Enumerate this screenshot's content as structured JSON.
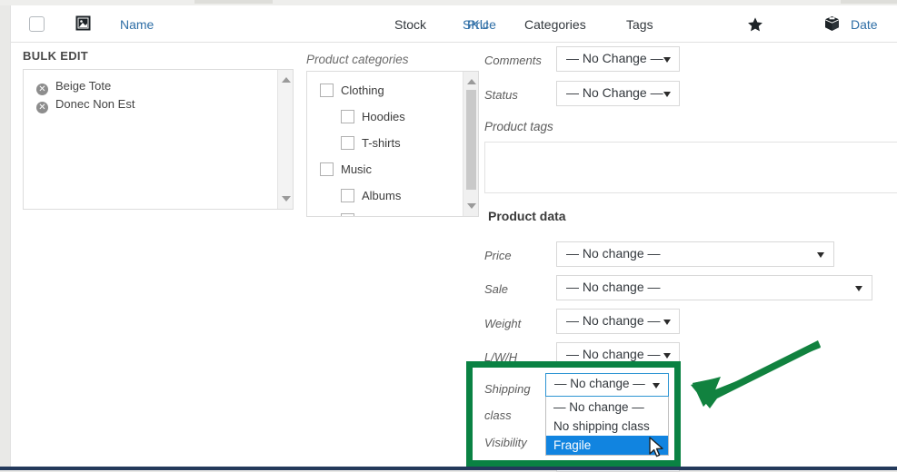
{
  "table_header": {
    "checkbox_icon": "select-all-checkbox",
    "image_icon": "image-icon",
    "star_icon": "star-icon",
    "box_icon": "product-box-icon",
    "columns": [
      {
        "label": "Name",
        "link": true
      },
      {
        "label": "SKU",
        "link": true
      },
      {
        "label": "Stock",
        "link": false
      },
      {
        "label": "Price",
        "link": true
      },
      {
        "label": "Categories",
        "link": false
      },
      {
        "label": "Tags",
        "link": false
      },
      {
        "label": "Date",
        "link": true
      }
    ]
  },
  "bulk_edit": {
    "title": "BULK EDIT",
    "items": [
      {
        "label": "Beige Tote",
        "remove_icon": "remove-circle-icon"
      },
      {
        "label": "Donec Non Est",
        "remove_icon": "remove-circle-icon"
      }
    ],
    "scroll_up_icon": "scroll-up-arrow-icon",
    "scroll_down_icon": "scroll-down-arrow-icon"
  },
  "product_categories": {
    "title": "Product categories",
    "items": [
      {
        "label": "Clothing",
        "checked": false,
        "indent": 0
      },
      {
        "label": "Hoodies",
        "checked": false,
        "indent": 1
      },
      {
        "label": "T-shirts",
        "checked": false,
        "indent": 1
      },
      {
        "label": "Music",
        "checked": false,
        "indent": 0
      },
      {
        "label": "Albums",
        "checked": false,
        "indent": 1
      }
    ],
    "scroll_up_icon": "scroll-up-arrow-icon",
    "scroll_down_icon": "scroll-down-arrow-icon"
  },
  "form": {
    "comments": {
      "label": "Comments",
      "value": "— No Change —"
    },
    "status": {
      "label": "Status",
      "value": "— No Change —"
    },
    "product_tags": {
      "label": "Product tags",
      "value": "",
      "placeholder": ""
    },
    "product_data_heading": "Product data",
    "price": {
      "label": "Price",
      "value": "— No change —"
    },
    "sale": {
      "label": "Sale",
      "value": "— No change —"
    },
    "weight": {
      "label": "Weight",
      "value": "— No change —"
    },
    "lwh": {
      "label": "L/W/H",
      "value": "— No change —"
    },
    "shipping_class": {
      "label_line1": "Shipping",
      "label_line2": "class",
      "value": "— No change —",
      "options": [
        {
          "label": "— No change —",
          "selected": false
        },
        {
          "label": "No shipping class",
          "selected": false
        },
        {
          "label": "Fragile",
          "selected": true
        }
      ]
    },
    "visibility": {
      "label": "Visibility"
    }
  },
  "annotation": {
    "highlight_color": "#0a8243",
    "arrow_color": "#11823f",
    "arrow_icon": "pointer-arrow-icon",
    "selection_color": "#1184e0",
    "cursor_icon": "mouse-cursor-icon"
  }
}
